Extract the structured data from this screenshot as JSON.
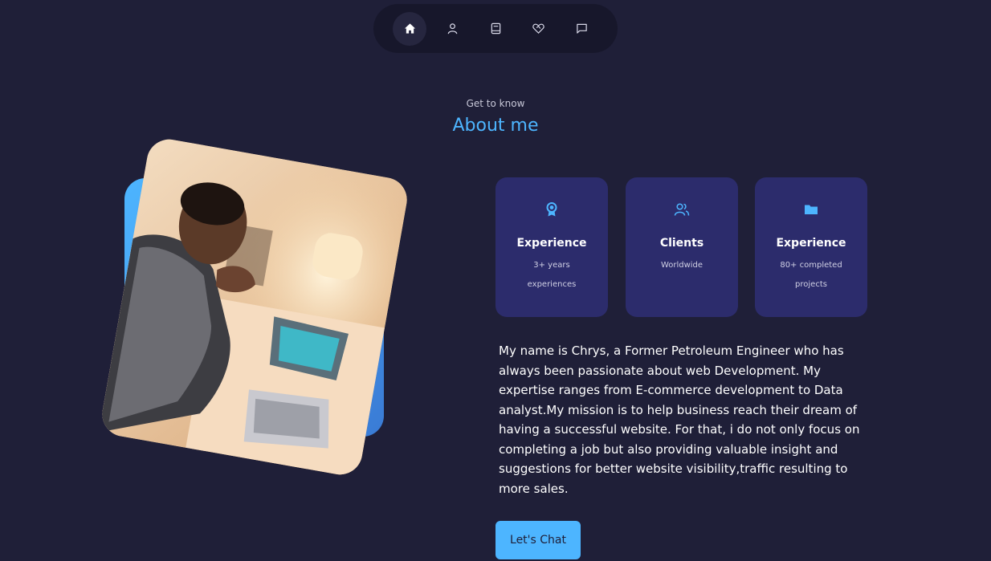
{
  "nav": {
    "items": [
      {
        "icon": "home-icon",
        "active": true
      },
      {
        "icon": "user-icon",
        "active": false
      },
      {
        "icon": "book-icon",
        "active": false
      },
      {
        "icon": "handshake-icon",
        "active": false
      },
      {
        "icon": "message-icon",
        "active": false
      }
    ]
  },
  "header": {
    "small": "Get to know",
    "title": "About me"
  },
  "cards": [
    {
      "icon": "award-icon",
      "title": "Experience",
      "subtitle": "3+ years experiences"
    },
    {
      "icon": "users-icon",
      "title": "Clients",
      "subtitle": "Worldwide"
    },
    {
      "icon": "folder-icon",
      "title": "Experience",
      "subtitle": "80+ completed projects"
    }
  ],
  "about": {
    "text": "My name is Chrys, a Former Petroleum Engineer who has always been passionate about web Development. My expertise ranges from E-commerce development to Data analyst.My mission is to help business reach their dream of having a successful website. For that, i do not only focus on completing a job but also providing valuable insight and suggestions for better website visibility,traffic resulting to more sales."
  },
  "cta": {
    "label": "Let's Chat"
  },
  "colors": {
    "background": "#1f1f38",
    "accent": "#4db5ff",
    "card": "#2c2c6c"
  }
}
